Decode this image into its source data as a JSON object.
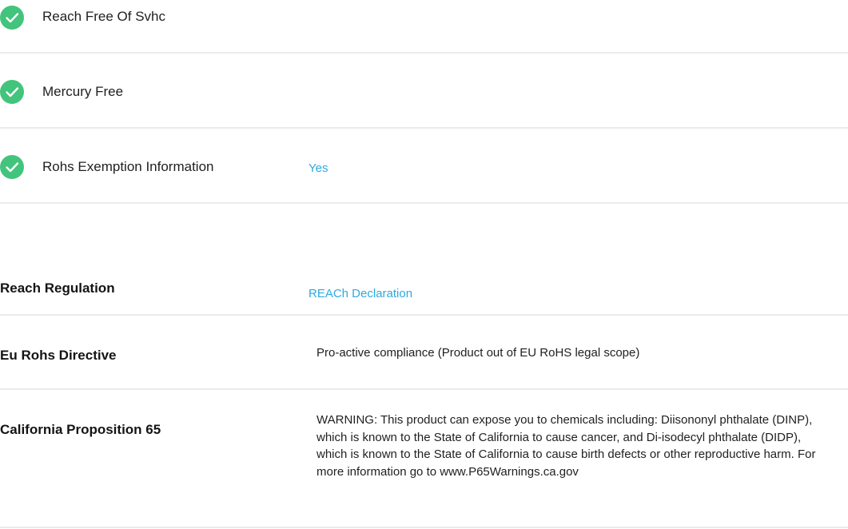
{
  "compliance_checks": [
    {
      "label": "Reach Free Of Svhc",
      "value": "",
      "status": "pass"
    },
    {
      "label": "Mercury Free",
      "value": "",
      "status": "pass"
    },
    {
      "label": "Rohs Exemption Information",
      "value": "Yes",
      "status": "pass"
    }
  ],
  "regulations": [
    {
      "label": "Reach Regulation",
      "value": "REACh Declaration"
    },
    {
      "label": "Eu Rohs Directive",
      "value": "Pro-active compliance (Product out of EU RoHS legal scope)"
    },
    {
      "label": "California Proposition 65",
      "value": "WARNING: This product can expose you to chemicals including: Diisononyl phthalate (DINP), which is known to the State of California to cause cancer, and Di-isodecyl phthalate (DIDP), which is known to the State of California to cause birth defects or other reproductive harm. For more information go to www.P65Warnings.ca.gov"
    }
  ],
  "colors": {
    "check_icon": "#42c47c",
    "link": "#2ea9e0",
    "divider": "#ebebeb"
  },
  "icons": {
    "check": "check-circle-icon"
  }
}
